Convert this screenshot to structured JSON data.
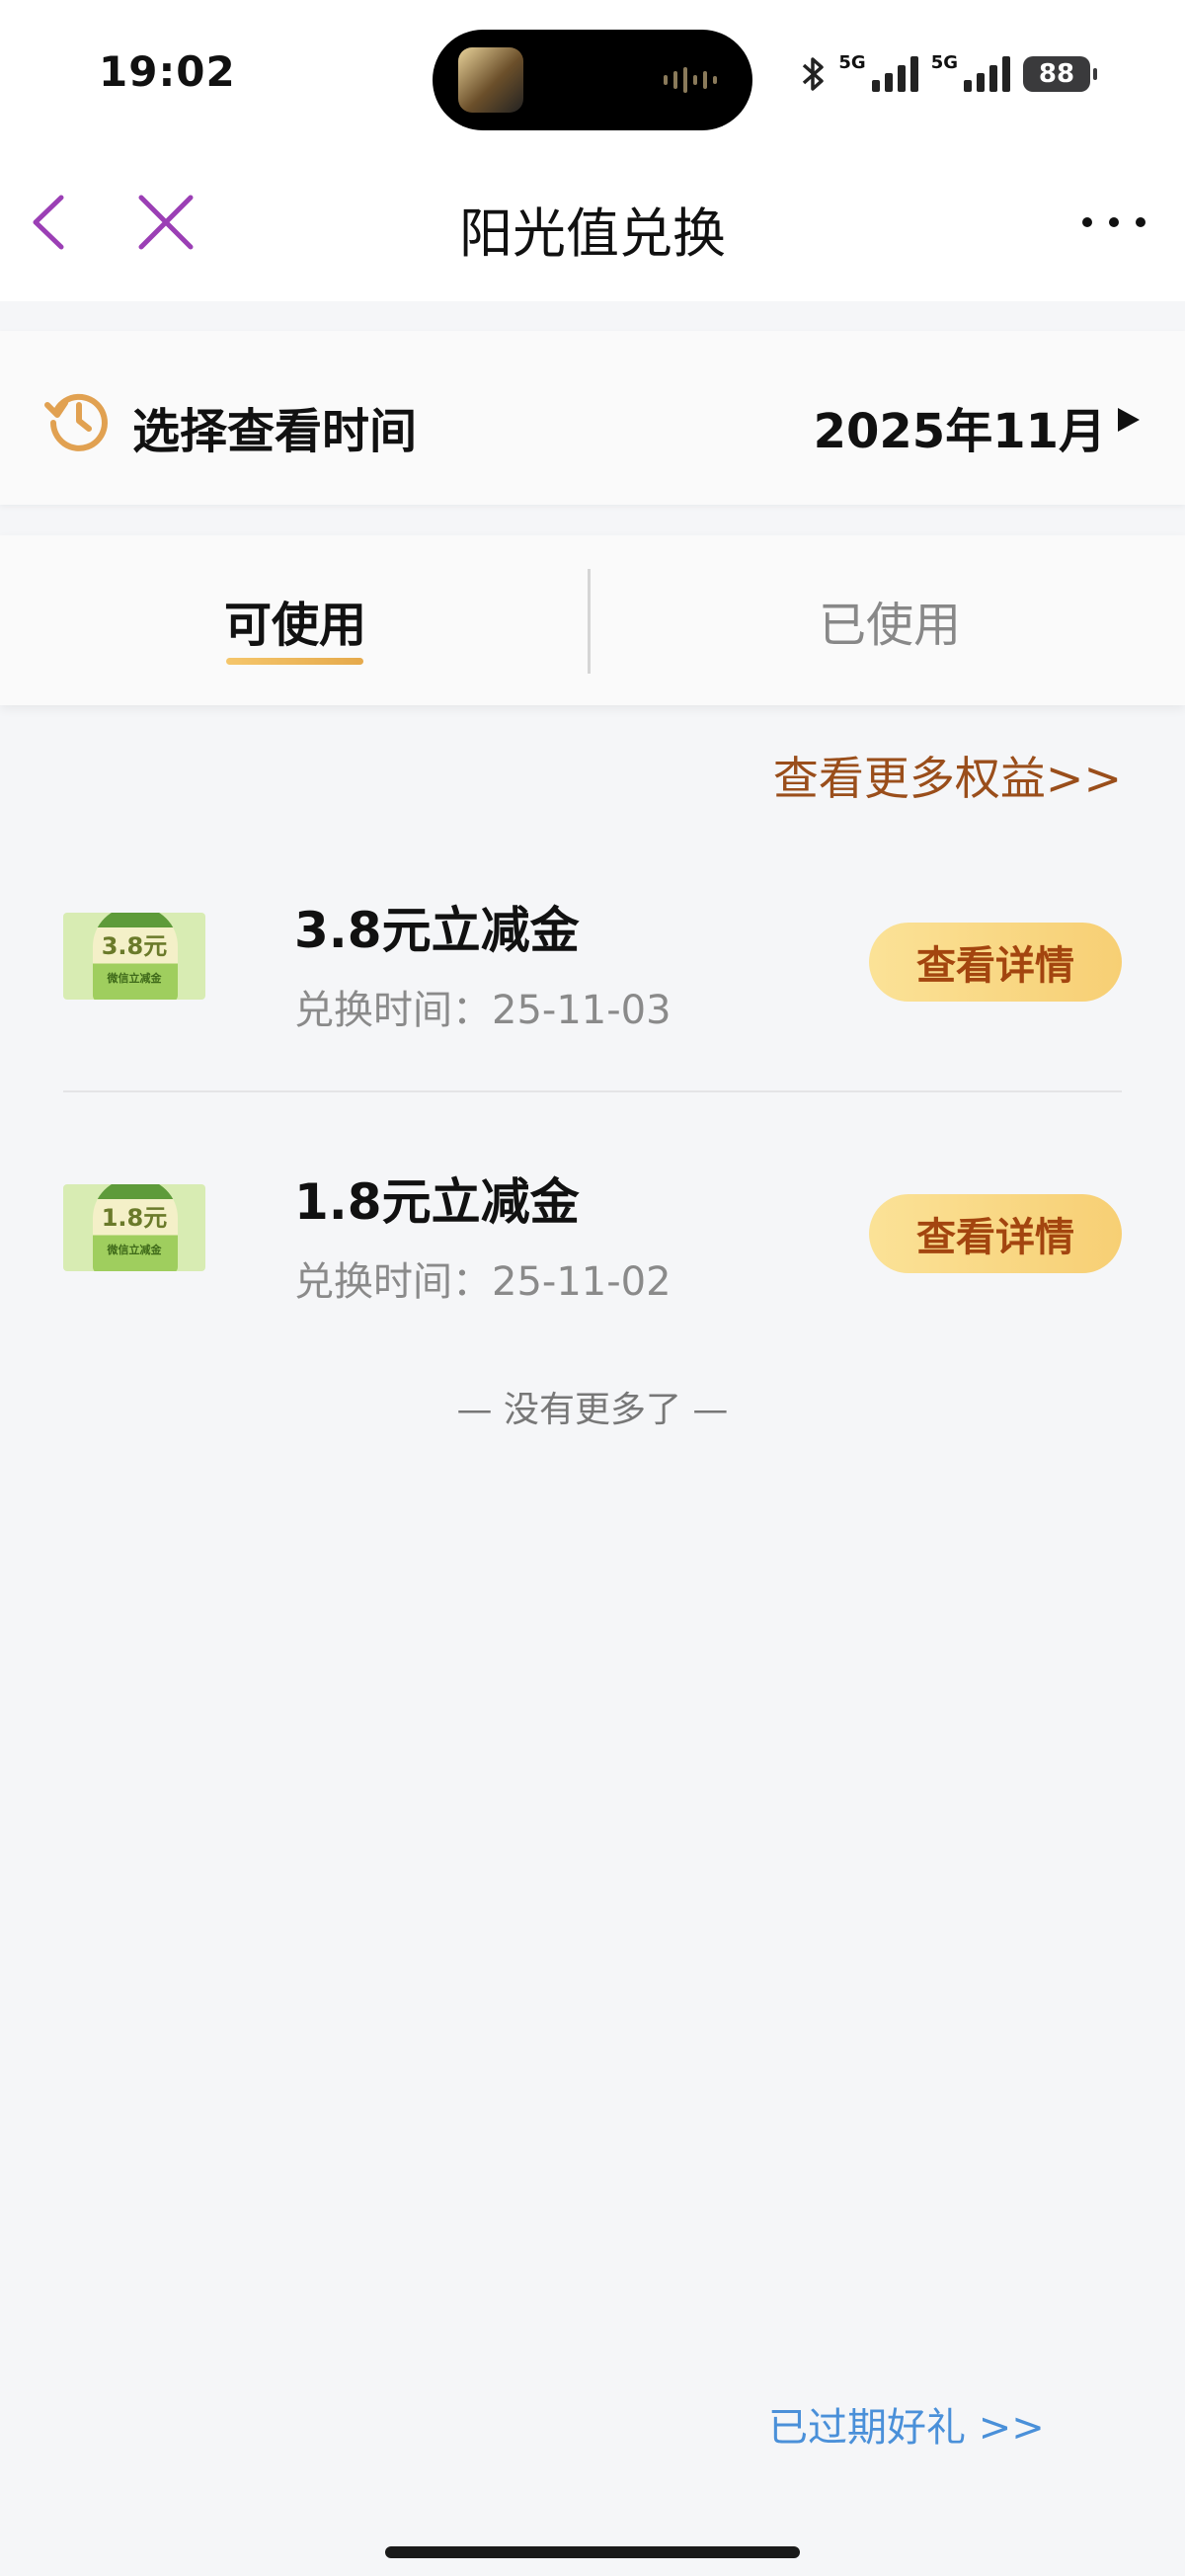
{
  "status_bar": {
    "time": "19:02",
    "network_1": "5G",
    "network_2": "5G",
    "battery": "88"
  },
  "nav": {
    "title": "阳光值兑换"
  },
  "time_selector": {
    "label": "选择查看时间",
    "value": "2025年11月"
  },
  "tabs": [
    {
      "label": "可使用",
      "active": true
    },
    {
      "label": "已使用",
      "active": false
    }
  ],
  "more_link": "查看更多权益>>",
  "vouchers": [
    {
      "image_amount": "3.8元",
      "image_caption": "微信立减金",
      "title": "3.8元立减金",
      "time": "兑换时间：25-11-03",
      "button": "查看详情"
    },
    {
      "image_amount": "1.8元",
      "image_caption": "微信立减金",
      "title": "1.8元立减金",
      "time": "兑换时间：25-11-02",
      "button": "查看详情"
    }
  ],
  "end_text": "— 没有更多了 —",
  "expired_link": "已过期好礼 >>",
  "colors": {
    "accent_purple": "#9b3fb5",
    "tab_underline": "#e5a94b",
    "link_brown": "#9a4e1b",
    "button_text": "#a3450f",
    "link_blue": "#4a90d9"
  }
}
